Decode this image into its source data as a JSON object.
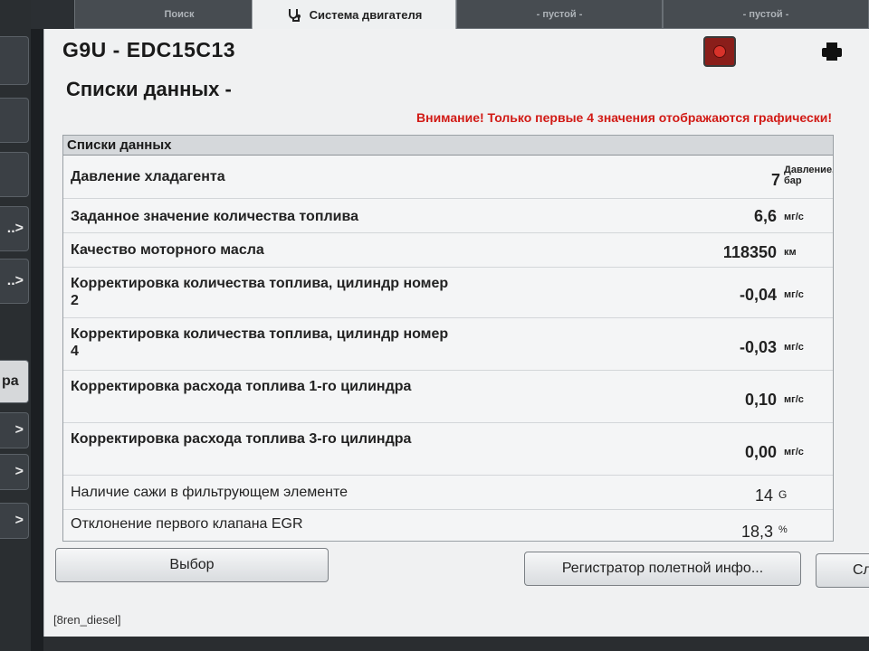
{
  "tabs": [
    {
      "label": "Поиск"
    },
    {
      "label": "Система двигателя"
    },
    {
      "label": "- пустой -"
    },
    {
      "label": "- пустой -"
    }
  ],
  "side_buttons": [
    {
      "label": ""
    },
    {
      "label": ""
    },
    {
      "label": ""
    },
    {
      "label": "..>"
    },
    {
      "label": "..>"
    },
    {
      "label": "ра"
    },
    {
      "label": ">"
    },
    {
      "label": ">"
    },
    {
      "label": ">"
    }
  ],
  "header": {
    "ecu_title": "G9U - EDC15C13",
    "page_title": "Списки данных -",
    "warning": "Внимание! Только первые 4 значения отображаются графически!"
  },
  "list": {
    "header": "Списки данных",
    "rows": [
      {
        "label": "Давление хладагента",
        "value": "7",
        "unit": "Давление, бар"
      },
      {
        "label": "Заданное значение количества топлива",
        "value": "6,6",
        "unit": "мг/с"
      },
      {
        "label": "Качество моторного масла",
        "value": "118350",
        "unit": "км"
      },
      {
        "label": "Корректировка количества топлива, цилиндр номер 2",
        "value": "-0,04",
        "unit": "мг/с"
      },
      {
        "label": "Корректировка количества топлива, цилиндр номер 4",
        "value": "-0,03",
        "unit": "мг/с"
      },
      {
        "label": "Корректировка расхода топлива 1-го цилиндра",
        "value": "0,10",
        "unit": "мг/с"
      },
      {
        "label": "Корректировка расхода топлива 3-го цилиндра",
        "value": "0,00",
        "unit": "мг/с"
      },
      {
        "label": "Наличие сажи в фильтрующем элементе",
        "value": "14",
        "unit": "G"
      },
      {
        "label": "Отклонение первого клапана EGR",
        "value": "18,3",
        "unit": "%"
      }
    ]
  },
  "footer": {
    "select_button": "Выбор",
    "recorder_button": "Регистратор полетной инфо...",
    "next_button_partial": "Сл",
    "status_text": "[8ren_diesel]"
  },
  "colors": {
    "warning": "#d11a15",
    "stop_button": "#8a1e1a"
  },
  "icons": {
    "engine_tab": "stethoscope-icon",
    "stop": "stop-icon",
    "print": "printer-icon"
  }
}
